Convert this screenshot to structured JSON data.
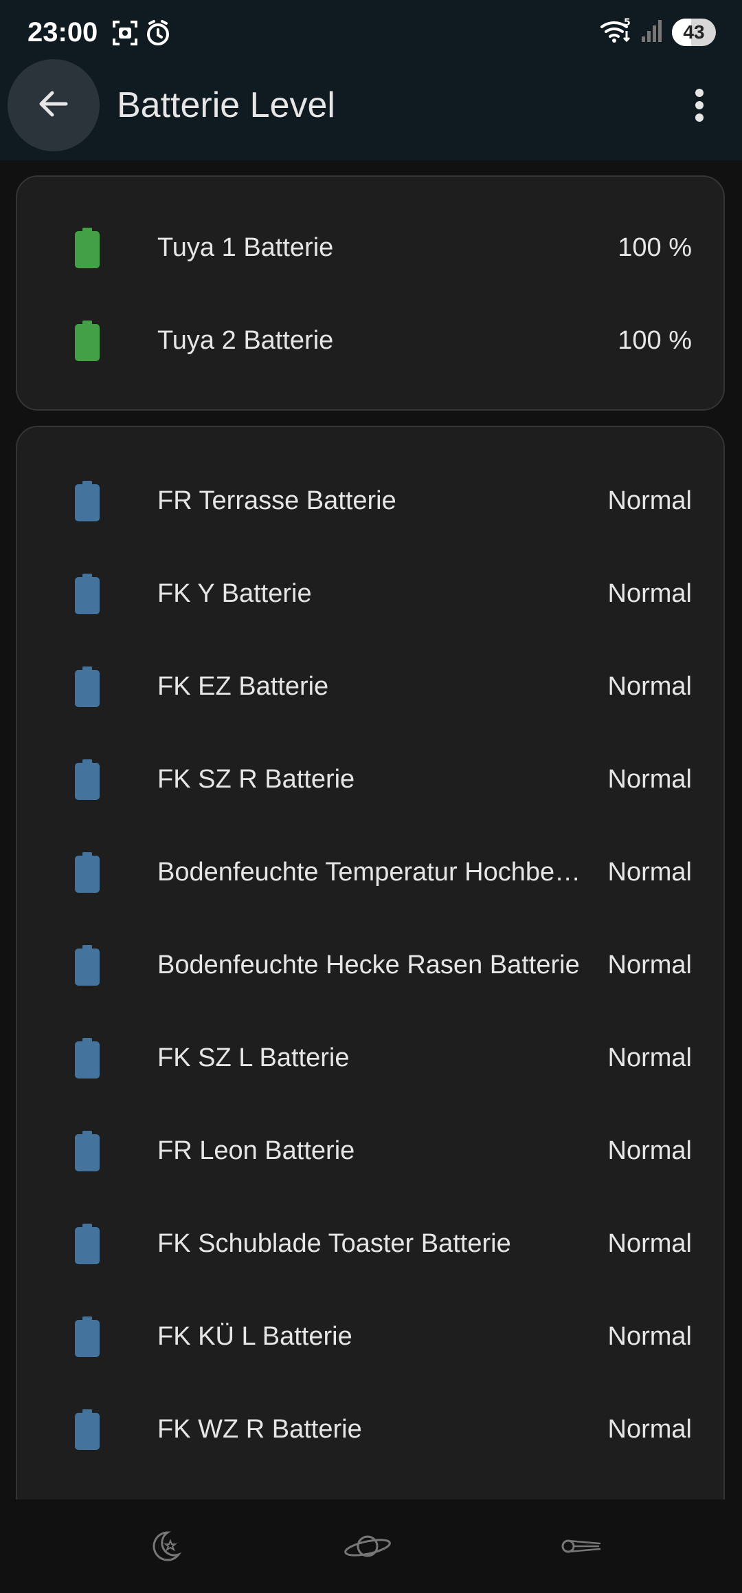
{
  "status_bar": {
    "time": "23:00",
    "battery_level": "43",
    "battery_fraction": 0.43,
    "icons": [
      "screenshot-icon",
      "alarm-icon",
      "wifi-icon",
      "cellular-signal-icon",
      "battery-icon"
    ]
  },
  "app_bar": {
    "title": "Batterie Level",
    "back_icon": "arrow-back-icon",
    "menu_icon": "more-vert-icon"
  },
  "colors": {
    "battery_green": "#43a047",
    "battery_blue": "#44739e",
    "card_bg": "#1e1e1e",
    "app_bar_bg": "#101b21"
  },
  "cards": [
    {
      "rows": [
        {
          "label": "Tuya 1 Batterie",
          "value": "100 %",
          "icon": "battery-full-icon",
          "color": "green"
        },
        {
          "label": "Tuya 2 Batterie",
          "value": "100 %",
          "icon": "battery-full-icon",
          "color": "green"
        }
      ]
    },
    {
      "rows": [
        {
          "label": "FR Terrasse Batterie",
          "value": "Normal",
          "icon": "battery-icon",
          "color": "blue"
        },
        {
          "label": "FK Y Batterie",
          "value": "Normal",
          "icon": "battery-icon",
          "color": "blue"
        },
        {
          "label": "FK EZ Batterie",
          "value": "Normal",
          "icon": "battery-icon",
          "color": "blue"
        },
        {
          "label": "FK SZ R Batterie",
          "value": "Normal",
          "icon": "battery-icon",
          "color": "blue"
        },
        {
          "label": "Bodenfeuchte Temperatur Hochbe…",
          "value": "Normal",
          "icon": "battery-icon",
          "color": "blue"
        },
        {
          "label": "Bodenfeuchte Hecke Rasen Batterie",
          "value": "Normal",
          "icon": "battery-icon",
          "color": "blue"
        },
        {
          "label": "FK SZ L Batterie",
          "value": "Normal",
          "icon": "battery-icon",
          "color": "blue"
        },
        {
          "label": "FR Leon Batterie",
          "value": "Normal",
          "icon": "battery-icon",
          "color": "blue"
        },
        {
          "label": "FK Schublade Toaster Batterie",
          "value": "Normal",
          "icon": "battery-icon",
          "color": "blue"
        },
        {
          "label": "FK KÜ L Batterie",
          "value": "Normal",
          "icon": "battery-icon",
          "color": "blue"
        },
        {
          "label": "FK WZ R Batterie",
          "value": "Normal",
          "icon": "battery-icon",
          "color": "blue"
        }
      ]
    }
  ],
  "bottom_nav": [
    {
      "icon": "moon-star-icon"
    },
    {
      "icon": "planet-icon"
    },
    {
      "icon": "comet-icon"
    }
  ]
}
